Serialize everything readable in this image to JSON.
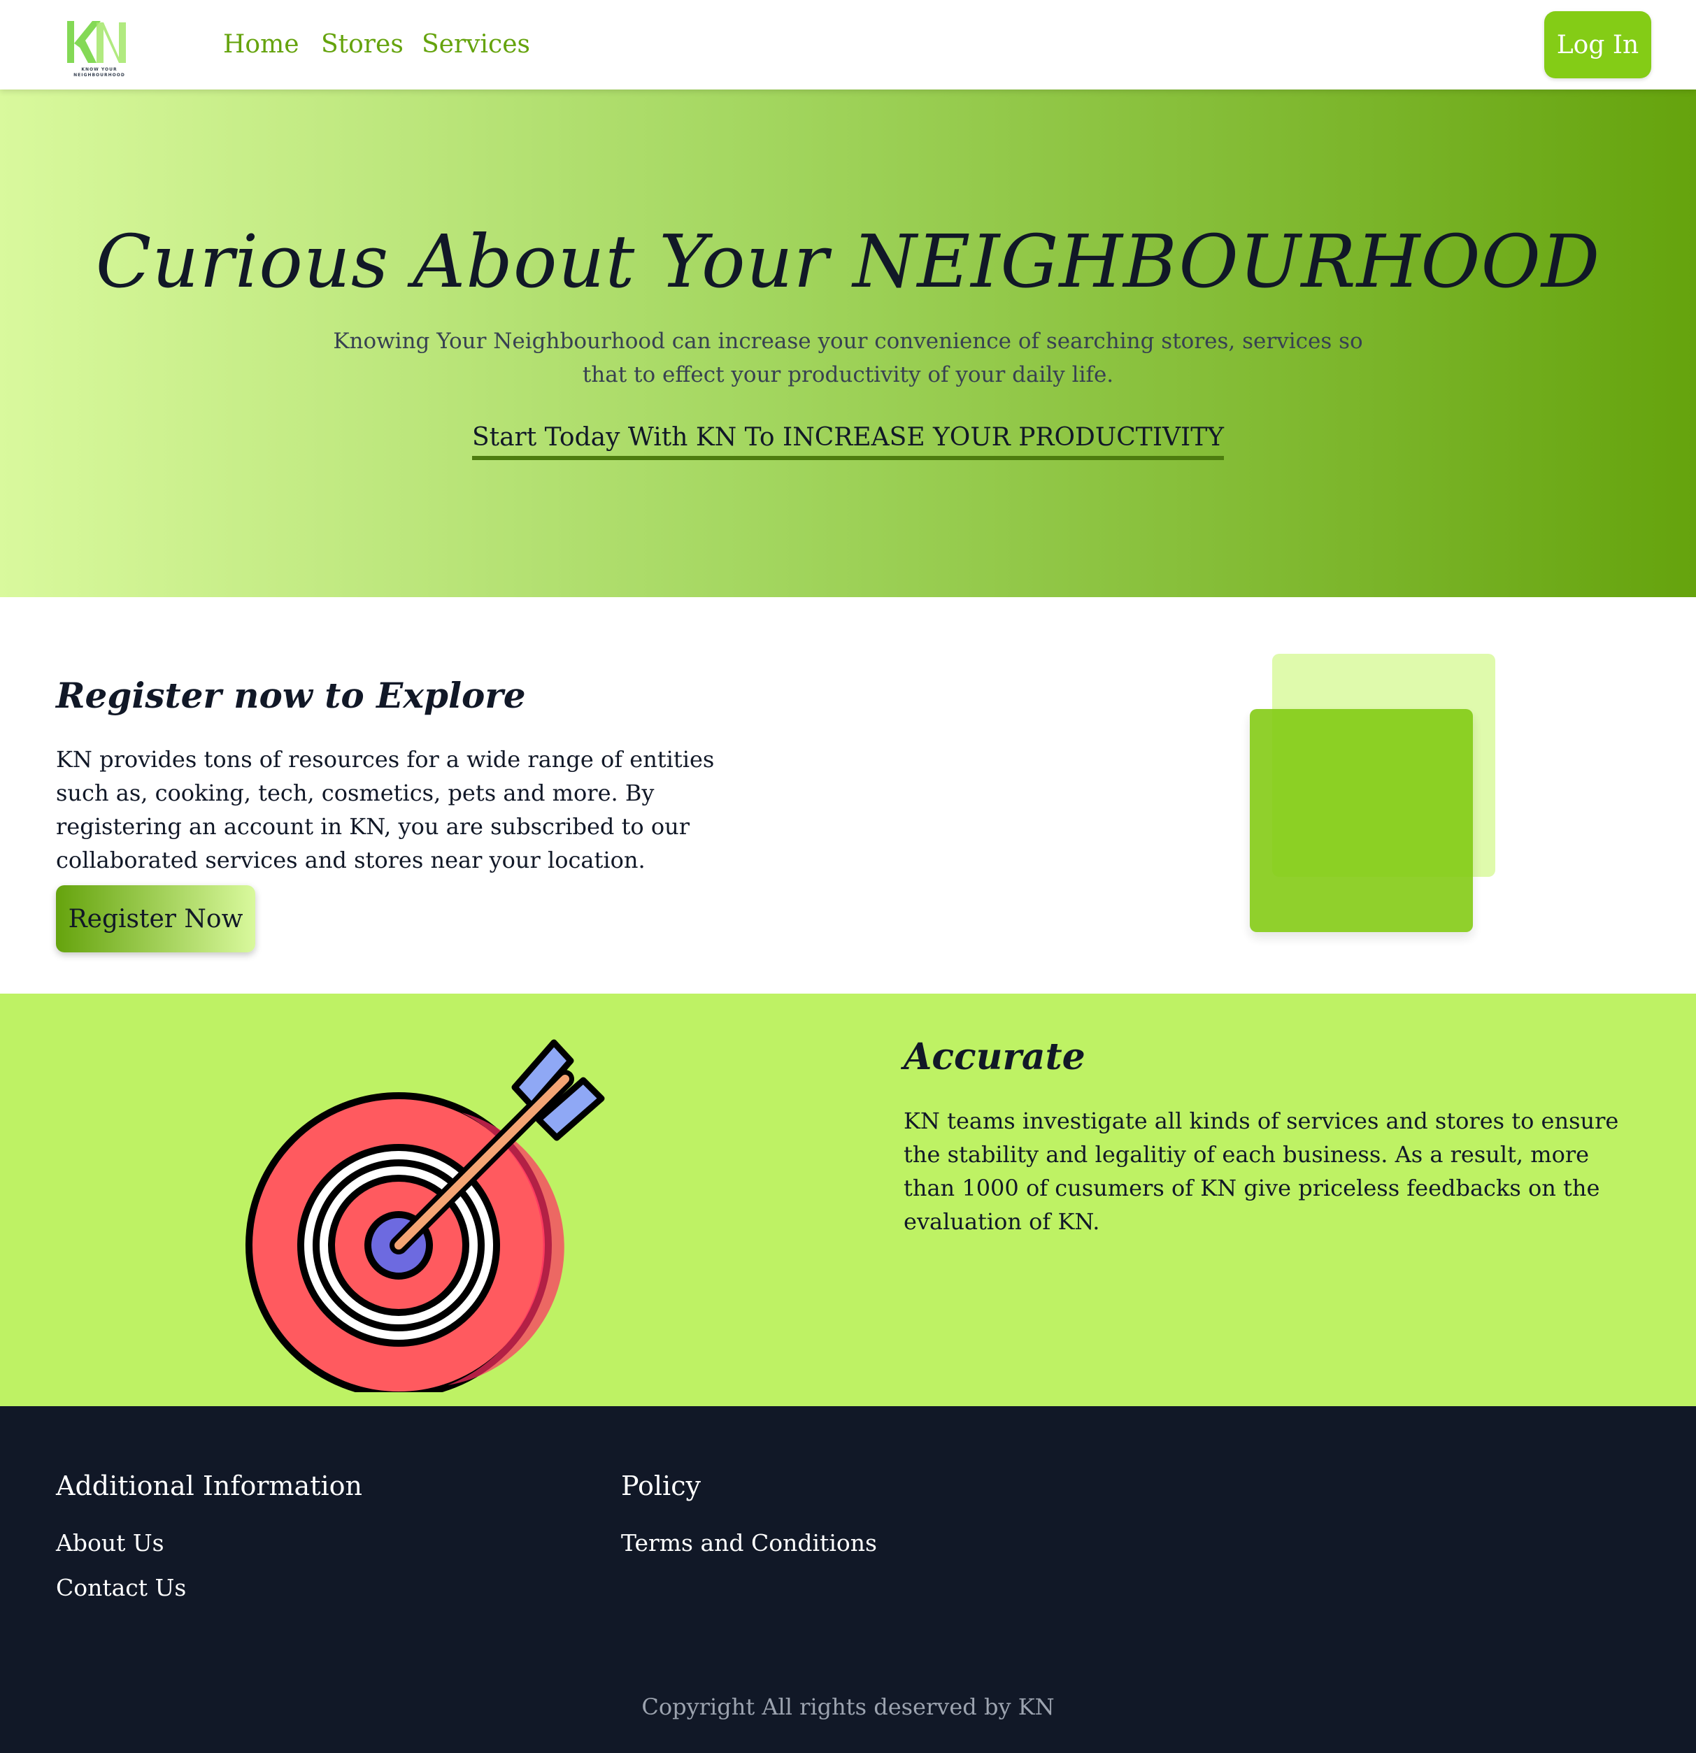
{
  "nav": {
    "logo_alt": "KN",
    "logo_tagline": "KNOW YOUR NEIGHBOURHOOD",
    "links": [
      "Home",
      "Stores",
      "Services"
    ],
    "login_label": "Log In"
  },
  "hero": {
    "title": "Curious About Your NEIGHBOURHOOD",
    "subtitle": "Knowing Your Neighbourhood can increase your convenience of searching stores, services so that to effect your productivity of your daily life.",
    "cta": "Start Today With KN To INCREASE YOUR PRODUCTIVITY"
  },
  "register": {
    "title": "Register now to Explore",
    "body": "KN provides tons of resources for a wide range of entities such as, cooking, tech, cosmetics, pets and more. By registering an account in KN, you are subscribed to our collaborated services and stores near your location.",
    "button_label": "Register Now"
  },
  "accurate": {
    "icon": "target-arrow-icon",
    "title": "Accurate",
    "body": "KN teams investigate all kinds of services and stores to ensure the stability and legalitiy of each business. As a result, more than 1000 of cusumers of KN give priceless feedbacks on the evaluation of KN."
  },
  "footer": {
    "additional": {
      "heading": "Additional Information",
      "links": [
        "About Us",
        "Contact Us"
      ]
    },
    "policy": {
      "heading": "Policy",
      "links": [
        "Terms and Conditions"
      ]
    },
    "copyright": "Copyright All rights deserved by KN"
  },
  "colors": {
    "accent": "#84cc16",
    "nav_link": "#65a30d",
    "hero_gradient_start": "#d9f99d",
    "hero_gradient_end": "#65a30d",
    "accurate_bg": "#bef264",
    "footer_bg": "#111827"
  }
}
